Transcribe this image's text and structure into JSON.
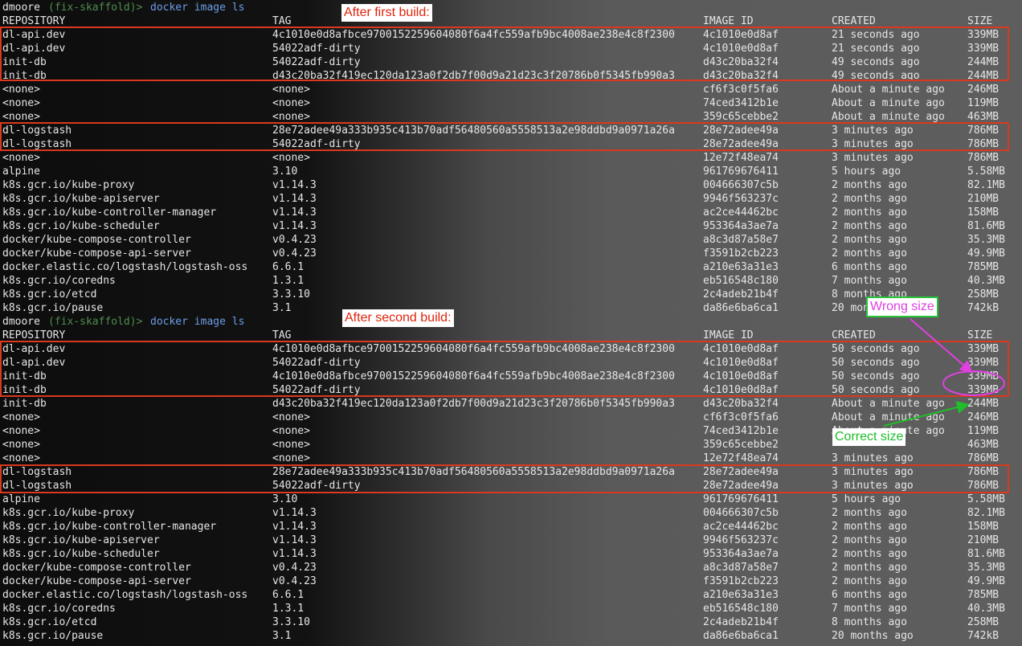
{
  "prompt1": {
    "user": "dmoore",
    "branch": "(fix-skaffold)>",
    "command": "docker image ls"
  },
  "prompt2": {
    "user": "dmoore",
    "branch": "(fix-skaffold)>",
    "command": "docker image ls"
  },
  "columns": {
    "repo": "REPOSITORY",
    "tag": "TAG",
    "id": "IMAGE ID",
    "created": "CREATED",
    "size": "SIZE"
  },
  "table1": [
    {
      "repo": "dl-api.dev",
      "tag": "4c1010e0d8afbce9700152259604080f6a4fc559afb9bc4008ae238e4c8f2300",
      "id": "4c1010e0d8af",
      "created": "21 seconds ago",
      "size": "339MB"
    },
    {
      "repo": "dl-api.dev",
      "tag": "54022adf-dirty",
      "id": "4c1010e0d8af",
      "created": "21 seconds ago",
      "size": "339MB"
    },
    {
      "repo": "init-db",
      "tag": "54022adf-dirty",
      "id": "d43c20ba32f4",
      "created": "49 seconds ago",
      "size": "244MB"
    },
    {
      "repo": "init-db",
      "tag": "d43c20ba32f419ec120da123a0f2db7f00d9a21d23c3f20786b0f5345fb990a3",
      "id": "d43c20ba32f4",
      "created": "49 seconds ago",
      "size": "244MB"
    },
    {
      "repo": "<none>",
      "tag": "<none>",
      "id": "cf6f3c0f5fa6",
      "created": "About a minute ago",
      "size": "246MB"
    },
    {
      "repo": "<none>",
      "tag": "<none>",
      "id": "74ced3412b1e",
      "created": "About a minute ago",
      "size": "119MB"
    },
    {
      "repo": "<none>",
      "tag": "<none>",
      "id": "359c65cebbe2",
      "created": "About a minute ago",
      "size": "463MB"
    },
    {
      "repo": "dl-logstash",
      "tag": "28e72adee49a333b935c413b70adf56480560a5558513a2e98ddbd9a0971a26a",
      "id": "28e72adee49a",
      "created": "3 minutes ago",
      "size": "786MB"
    },
    {
      "repo": "dl-logstash",
      "tag": "54022adf-dirty",
      "id": "28e72adee49a",
      "created": "3 minutes ago",
      "size": "786MB"
    },
    {
      "repo": "<none>",
      "tag": "<none>",
      "id": "12e72f48ea74",
      "created": "3 minutes ago",
      "size": "786MB"
    },
    {
      "repo": "alpine",
      "tag": "3.10",
      "id": "961769676411",
      "created": "5 hours ago",
      "size": "5.58MB"
    },
    {
      "repo": "k8s.gcr.io/kube-proxy",
      "tag": "v1.14.3",
      "id": "004666307c5b",
      "created": "2 months ago",
      "size": "82.1MB"
    },
    {
      "repo": "k8s.gcr.io/kube-apiserver",
      "tag": "v1.14.3",
      "id": "9946f563237c",
      "created": "2 months ago",
      "size": "210MB"
    },
    {
      "repo": "k8s.gcr.io/kube-controller-manager",
      "tag": "v1.14.3",
      "id": "ac2ce44462bc",
      "created": "2 months ago",
      "size": "158MB"
    },
    {
      "repo": "k8s.gcr.io/kube-scheduler",
      "tag": "v1.14.3",
      "id": "953364a3ae7a",
      "created": "2 months ago",
      "size": "81.6MB"
    },
    {
      "repo": "docker/kube-compose-controller",
      "tag": "v0.4.23",
      "id": "a8c3d87a58e7",
      "created": "2 months ago",
      "size": "35.3MB"
    },
    {
      "repo": "docker/kube-compose-api-server",
      "tag": "v0.4.23",
      "id": "f3591b2cb223",
      "created": "2 months ago",
      "size": "49.9MB"
    },
    {
      "repo": "docker.elastic.co/logstash/logstash-oss",
      "tag": "6.6.1",
      "id": "a210e63a31e3",
      "created": "6 months ago",
      "size": "785MB"
    },
    {
      "repo": "k8s.gcr.io/coredns",
      "tag": "1.3.1",
      "id": "eb516548c180",
      "created": "7 months ago",
      "size": "40.3MB"
    },
    {
      "repo": "k8s.gcr.io/etcd",
      "tag": "3.3.10",
      "id": "2c4adeb21b4f",
      "created": "8 months ago",
      "size": "258MB"
    },
    {
      "repo": "k8s.gcr.io/pause",
      "tag": "3.1",
      "id": "da86e6ba6ca1",
      "created": "20 months ago",
      "size": "742kB"
    }
  ],
  "table2": [
    {
      "repo": "dl-api.dev",
      "tag": "4c1010e0d8afbce9700152259604080f6a4fc559afb9bc4008ae238e4c8f2300",
      "id": "4c1010e0d8af",
      "created": "50 seconds ago",
      "size": "339MB"
    },
    {
      "repo": "dl-api.dev",
      "tag": "54022adf-dirty",
      "id": "4c1010e0d8af",
      "created": "50 seconds ago",
      "size": "339MB"
    },
    {
      "repo": "init-db",
      "tag": "4c1010e0d8afbce9700152259604080f6a4fc559afb9bc4008ae238e4c8f2300",
      "id": "4c1010e0d8af",
      "created": "50 seconds ago",
      "size": "339MB"
    },
    {
      "repo": "init-db",
      "tag": "54022adf-dirty",
      "id": "4c1010e0d8af",
      "created": "50 seconds ago",
      "size": "339MB"
    },
    {
      "repo": "init-db",
      "tag": "d43c20ba32f419ec120da123a0f2db7f00d9a21d23c3f20786b0f5345fb990a3",
      "id": "d43c20ba32f4",
      "created": "About a minute ago",
      "size": "244MB"
    },
    {
      "repo": "<none>",
      "tag": "<none>",
      "id": "cf6f3c0f5fa6",
      "created": "About a minute ago",
      "size": "246MB"
    },
    {
      "repo": "<none>",
      "tag": "<none>",
      "id": "74ced3412b1e",
      "created": "About a minute ago",
      "size": "119MB"
    },
    {
      "repo": "<none>",
      "tag": "<none>",
      "id": "359c65cebbe2",
      "created": "",
      "size": "463MB"
    },
    {
      "repo": "<none>",
      "tag": "<none>",
      "id": "12e72f48ea74",
      "created": "3 minutes ago",
      "size": "786MB"
    },
    {
      "repo": "dl-logstash",
      "tag": "28e72adee49a333b935c413b70adf56480560a5558513a2e98ddbd9a0971a26a",
      "id": "28e72adee49a",
      "created": "3 minutes ago",
      "size": "786MB"
    },
    {
      "repo": "dl-logstash",
      "tag": "54022adf-dirty",
      "id": "28e72adee49a",
      "created": "3 minutes ago",
      "size": "786MB"
    },
    {
      "repo": "alpine",
      "tag": "3.10",
      "id": "961769676411",
      "created": "5 hours ago",
      "size": "5.58MB"
    },
    {
      "repo": "k8s.gcr.io/kube-proxy",
      "tag": "v1.14.3",
      "id": "004666307c5b",
      "created": "2 months ago",
      "size": "82.1MB"
    },
    {
      "repo": "k8s.gcr.io/kube-controller-manager",
      "tag": "v1.14.3",
      "id": "ac2ce44462bc",
      "created": "2 months ago",
      "size": "158MB"
    },
    {
      "repo": "k8s.gcr.io/kube-apiserver",
      "tag": "v1.14.3",
      "id": "9946f563237c",
      "created": "2 months ago",
      "size": "210MB"
    },
    {
      "repo": "k8s.gcr.io/kube-scheduler",
      "tag": "v1.14.3",
      "id": "953364a3ae7a",
      "created": "2 months ago",
      "size": "81.6MB"
    },
    {
      "repo": "docker/kube-compose-controller",
      "tag": "v0.4.23",
      "id": "a8c3d87a58e7",
      "created": "2 months ago",
      "size": "35.3MB"
    },
    {
      "repo": "docker/kube-compose-api-server",
      "tag": "v0.4.23",
      "id": "f3591b2cb223",
      "created": "2 months ago",
      "size": "49.9MB"
    },
    {
      "repo": "docker.elastic.co/logstash/logstash-oss",
      "tag": "6.6.1",
      "id": "a210e63a31e3",
      "created": "6 months ago",
      "size": "785MB"
    },
    {
      "repo": "k8s.gcr.io/coredns",
      "tag": "1.3.1",
      "id": "eb516548c180",
      "created": "7 months ago",
      "size": "40.3MB"
    },
    {
      "repo": "k8s.gcr.io/etcd",
      "tag": "3.3.10",
      "id": "2c4adeb21b4f",
      "created": "8 months ago",
      "size": "258MB"
    },
    {
      "repo": "k8s.gcr.io/pause",
      "tag": "3.1",
      "id": "da86e6ba6ca1",
      "created": "20 months ago",
      "size": "742kB"
    }
  ],
  "annotations": {
    "after_first": "After first build:",
    "after_second": "After second build:",
    "wrong_size": "Wrong size",
    "correct_size": "Correct size"
  },
  "colors": {
    "box": "#d9391e",
    "label_text": "#e0230b",
    "wrong": "#e040e0",
    "correct": "#1fbe2b"
  }
}
